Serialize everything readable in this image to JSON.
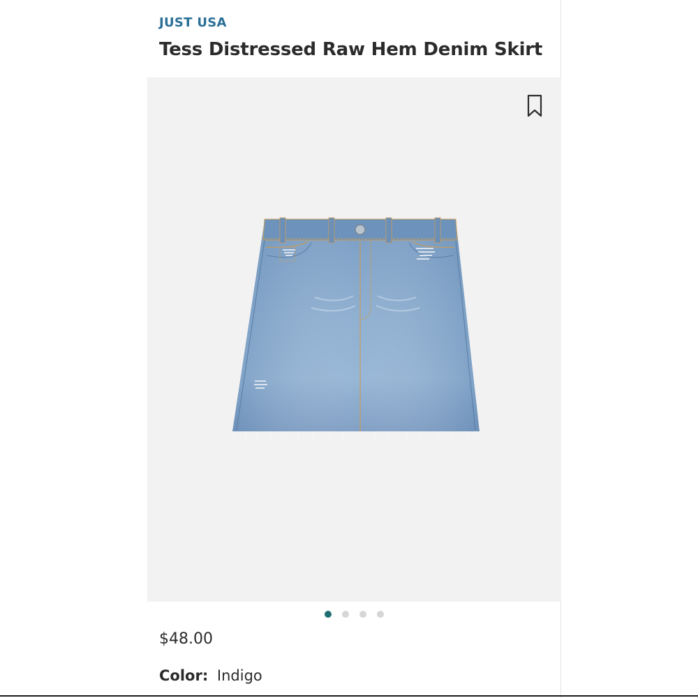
{
  "product": {
    "brand": "JUST USA",
    "title": "Tess Distressed Raw Hem Denim Skirt",
    "price": "$48.00",
    "color_label": "Color:",
    "color_value": "Indigo"
  },
  "gallery": {
    "image_count": 4,
    "active_index": 0
  },
  "colors": {
    "brand": "#2a6f97",
    "active_dot": "#1f6e73",
    "inactive_dot": "#d6d6d6",
    "image_background": "#f2f2f2",
    "denim": "#7fa3c9"
  },
  "icons": {
    "bookmark": "bookmark-icon"
  }
}
